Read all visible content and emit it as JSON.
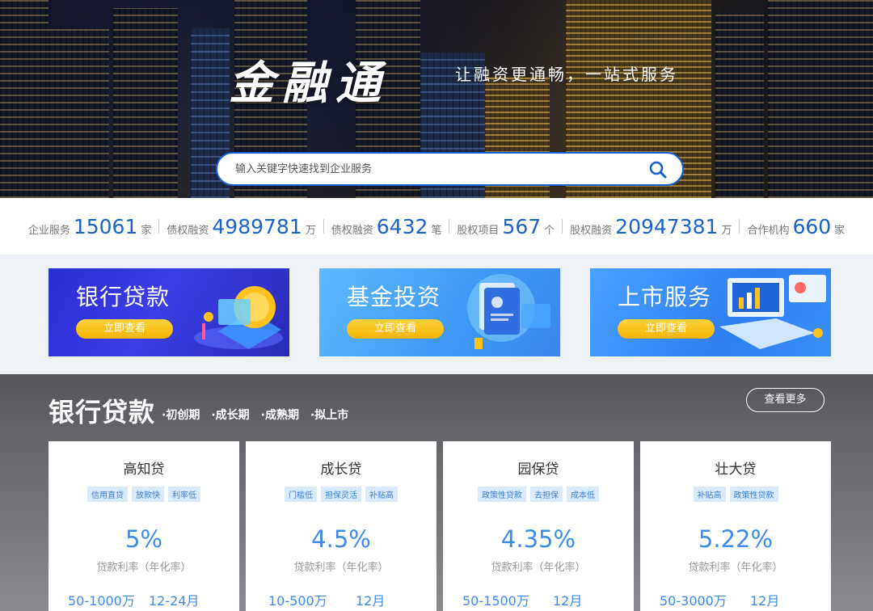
{
  "header": {
    "logo": "金融通",
    "slogan": "让融资更通畅，一站式服务",
    "search_placeholder": "输入关键字快速找到企业服务"
  },
  "stats": [
    {
      "label": "企业服务",
      "value": "15061",
      "unit": "家"
    },
    {
      "label": "债权融资",
      "value": "4989781",
      "unit": "万"
    },
    {
      "label": "债权融资",
      "value": "6432",
      "unit": "笔"
    },
    {
      "label": "股权项目",
      "value": "567",
      "unit": "个"
    },
    {
      "label": "股权融资",
      "value": "20947381",
      "unit": "万"
    },
    {
      "label": "合作机构",
      "value": "660",
      "unit": "家"
    }
  ],
  "banners": [
    {
      "title": "银行贷款",
      "button": "立即查看"
    },
    {
      "title": "基金投资",
      "button": "立即查看"
    },
    {
      "title": "上市服务",
      "button": "立即查看"
    }
  ],
  "loans": {
    "title": "银行贷款",
    "stages": [
      "·初创期",
      "·成长期",
      "·成熟期",
      "·拟上市"
    ],
    "more": "查看更多",
    "rate_label": "贷款利率（年化率）",
    "cards": [
      {
        "name": "高知贷",
        "tags": [
          "信用直贷",
          "放款快",
          "利率低"
        ],
        "rate": "5%",
        "amount": "50-1000万",
        "term": "12-24月"
      },
      {
        "name": "成长贷",
        "tags": [
          "门槛低",
          "担保灵活",
          "补贴高"
        ],
        "rate": "4.5%",
        "amount": "10-500万",
        "term": "12月"
      },
      {
        "name": "园保贷",
        "tags": [
          "政策性贷款",
          "去担保",
          "成本低"
        ],
        "rate": "4.35%",
        "amount": "50-1500万",
        "term": "12月"
      },
      {
        "name": "壮大贷",
        "tags": [
          "补贴高",
          "政策性贷款"
        ],
        "rate": "5.22%",
        "amount": "50-3000万",
        "term": "12月"
      }
    ]
  }
}
